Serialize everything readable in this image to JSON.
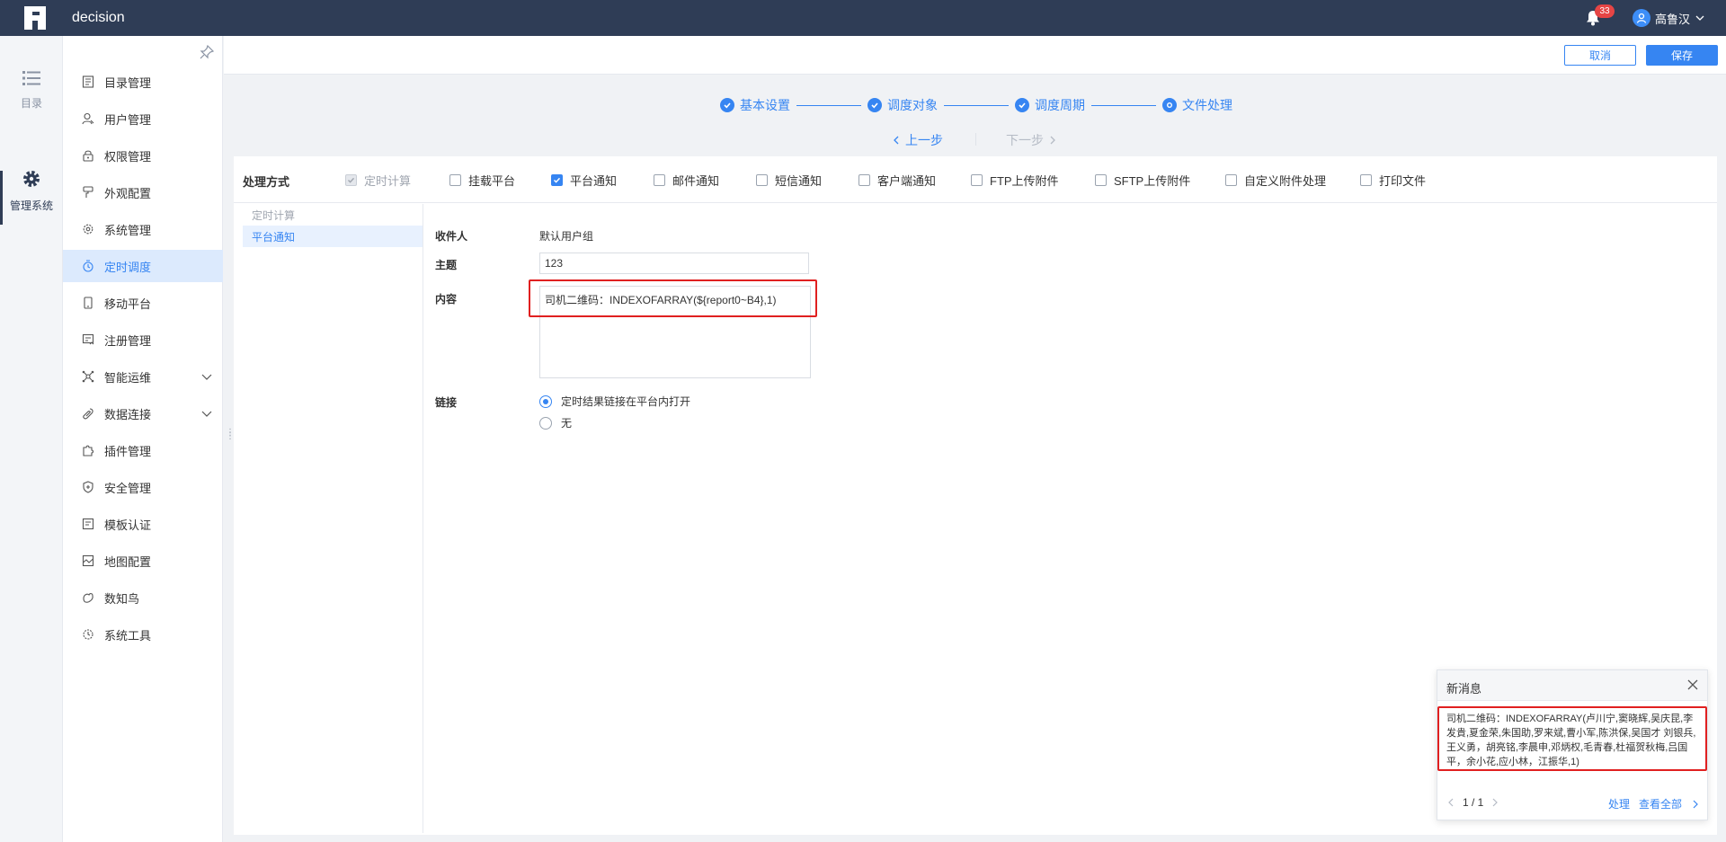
{
  "app": {
    "title": "decision"
  },
  "header": {
    "notification_count": "33",
    "user_name": "高鲁汉"
  },
  "rail": {
    "items": [
      {
        "label": "目录",
        "icon": "list-icon"
      },
      {
        "label": "管理系统",
        "icon": "gear-icon"
      }
    ]
  },
  "sidebar": {
    "items": [
      {
        "label": "目录管理",
        "icon": "catalog-icon"
      },
      {
        "label": "用户管理",
        "icon": "user-icon"
      },
      {
        "label": "权限管理",
        "icon": "lock-icon"
      },
      {
        "label": "外观配置",
        "icon": "brush-icon"
      },
      {
        "label": "系统管理",
        "icon": "gear-icon"
      },
      {
        "label": "定时调度",
        "icon": "timer-icon"
      },
      {
        "label": "移动平台",
        "icon": "mobile-icon"
      },
      {
        "label": "注册管理",
        "icon": "register-icon"
      },
      {
        "label": "智能运维",
        "icon": "network-icon"
      },
      {
        "label": "数据连接",
        "icon": "link-icon"
      },
      {
        "label": "插件管理",
        "icon": "puzzle-icon"
      },
      {
        "label": "安全管理",
        "icon": "shield-icon"
      },
      {
        "label": "模板认证",
        "icon": "template-icon"
      },
      {
        "label": "地图配置",
        "icon": "map-icon"
      },
      {
        "label": "数知鸟",
        "icon": "bird-icon"
      },
      {
        "label": "系统工具",
        "icon": "tools-icon"
      }
    ]
  },
  "toolbar": {
    "cancel_label": "取消",
    "save_label": "保存"
  },
  "steps": {
    "items": [
      "基本设置",
      "调度对象",
      "调度周期",
      "文件处理"
    ],
    "prev_label": "上一步",
    "next_label": "下一步"
  },
  "methods": {
    "title": "处理方式",
    "options": [
      {
        "label": "定时计算",
        "state": "disabled-checked"
      },
      {
        "label": "挂载平台",
        "state": "unchecked"
      },
      {
        "label": "平台通知",
        "state": "checked"
      },
      {
        "label": "邮件通知",
        "state": "unchecked"
      },
      {
        "label": "短信通知",
        "state": "unchecked"
      },
      {
        "label": "客户端通知",
        "state": "unchecked"
      },
      {
        "label": "FTP上传附件",
        "state": "unchecked"
      },
      {
        "label": "SFTP上传附件",
        "state": "unchecked"
      },
      {
        "label": "自定义附件处理",
        "state": "unchecked"
      },
      {
        "label": "打印文件",
        "state": "unchecked"
      }
    ]
  },
  "subnav": {
    "items": [
      "定时计算",
      "平台通知"
    ]
  },
  "form": {
    "recipient_label": "收件人",
    "recipient_value": "默认用户组",
    "subject_label": "主题",
    "subject_value": "123",
    "content_label": "内容",
    "content_value": "司机二维码：INDEXOFARRAY(${report0~B4},1)",
    "link_label": "链接",
    "link_options": [
      "定时结果链接在平台内打开",
      "无"
    ]
  },
  "notice": {
    "title": "新消息",
    "body": "司机二维码：INDEXOFARRAY(卢川宁,窦晓辉,吴庆昆,李发貴,夏金荣,朱国助,罗来斌,曹小军,陈洪保,吴国才 刘银兵,王义勇，胡亮铭,李晨申,邓炳权,毛青春,杜福贺秋梅,吕国平，余小花,应小林，江振华,1)",
    "pager": "1 / 1",
    "handle_label": "处理",
    "view_all_label": "查看全部"
  },
  "colors": {
    "topbar": "#2f3d56",
    "accent": "#3685f2",
    "highlight": "#e02020"
  }
}
